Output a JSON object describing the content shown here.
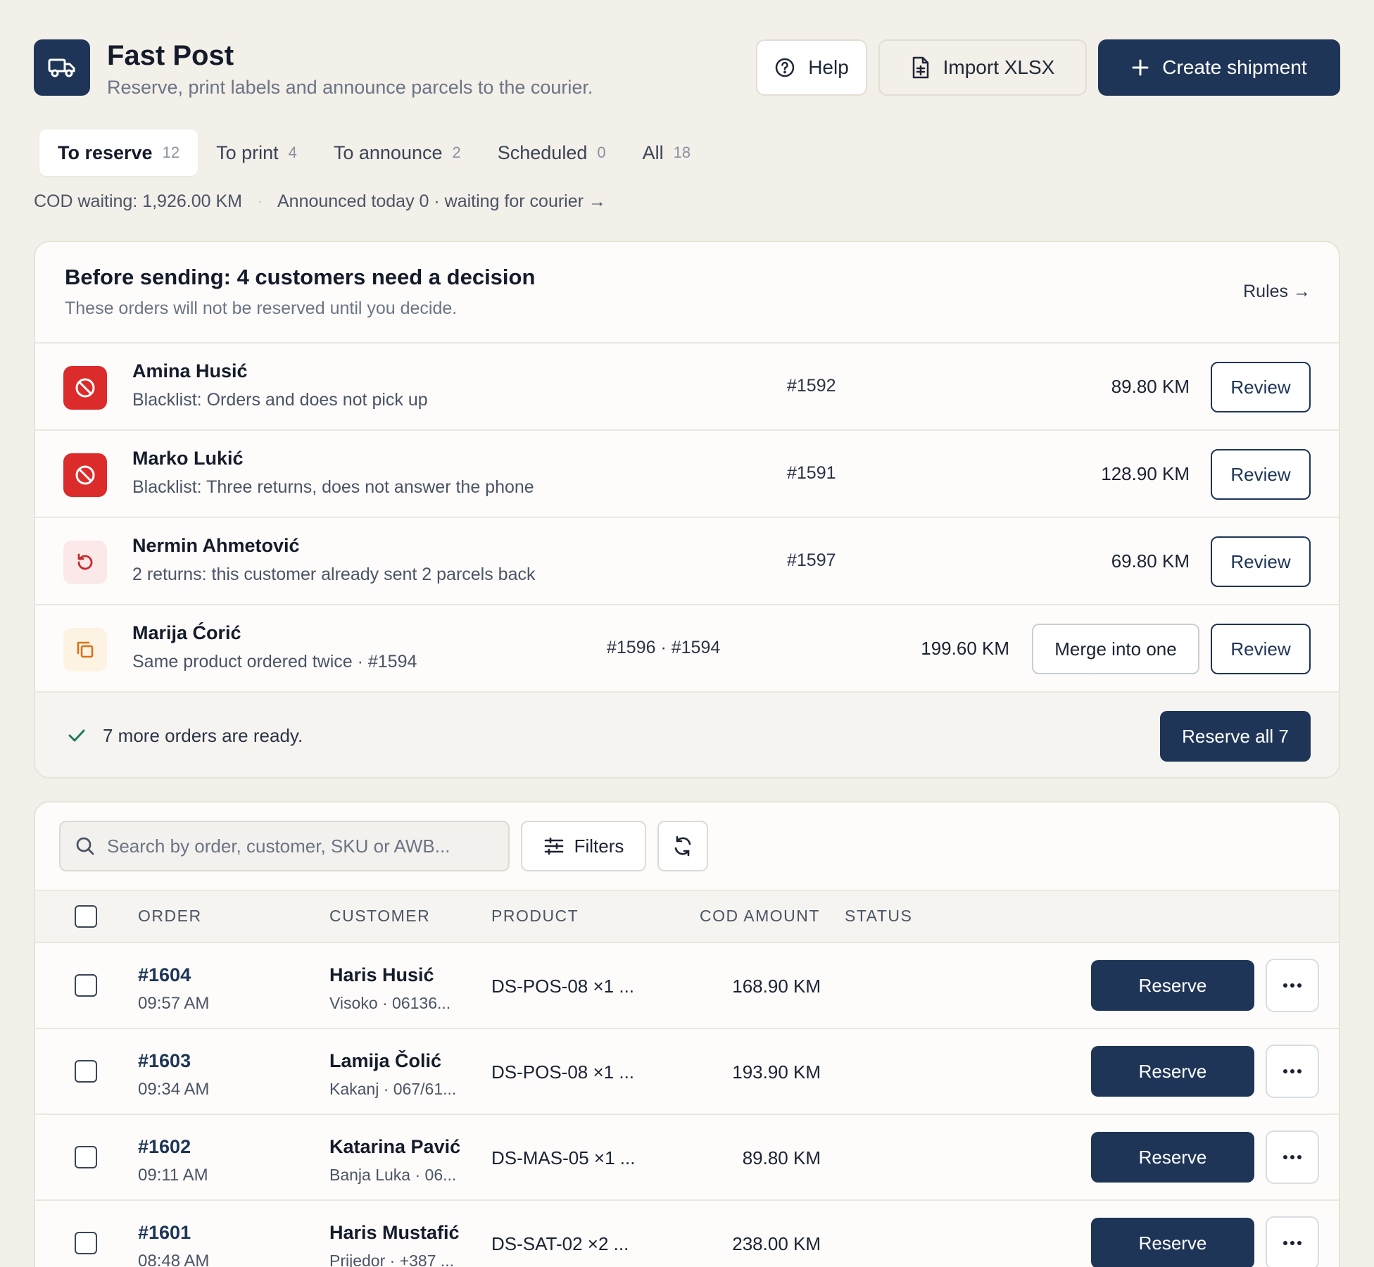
{
  "header": {
    "title": "Fast Post",
    "subtitle": "Reserve, print labels and announce parcels to the courier.",
    "help_label": "Help",
    "import_label": "Import XLSX",
    "create_label": "Create shipment",
    "logo_icon": "truck-icon"
  },
  "tabs": [
    {
      "label": "To reserve",
      "count": "12",
      "active": true
    },
    {
      "label": "To print",
      "count": "4"
    },
    {
      "label": "To announce",
      "count": "2"
    },
    {
      "label": "Scheduled",
      "count": "0"
    },
    {
      "label": "All",
      "count": "18"
    }
  ],
  "status_line": {
    "cod_waiting": "COD waiting: 1,926.00 KM",
    "announced": "Announced today 0 · waiting for courier →"
  },
  "decision": {
    "title": "Before sending: 4 customers need a decision",
    "subtitle": "These orders will not be reserved until you decide.",
    "rules_label": "Rules →",
    "review_label": "Review",
    "merge_label": "Merge into one",
    "rows": [
      {
        "name": "Amina Husić",
        "reason": "Blacklist: Orders and does not pick up",
        "order": "#1592",
        "amount": "89.80 KM",
        "icon": "blocked-icon"
      },
      {
        "name": "Marko Lukić",
        "reason": "Blacklist: Three returns, does not answer the phone",
        "order": "#1591",
        "amount": "128.90 KM",
        "icon": "blocked-icon"
      },
      {
        "name": "Nermin Ahmetović",
        "reason": "2 returns: this customer already sent 2 parcels back",
        "order": "#1597",
        "amount": "69.80 KM",
        "icon": "return-icon"
      },
      {
        "name": "Marija Ćorić",
        "reason": "Same product ordered twice · #1594",
        "order": "#1596 · #1594",
        "amount": "199.60 KM",
        "icon": "duplicate-icon"
      }
    ],
    "ready_text": "7 more orders are ready.",
    "reserve_all_label": "Reserve all 7"
  },
  "orders": {
    "search_placeholder": "Search by order, customer, SKU or AWB...",
    "filters_label": "Filters",
    "columns": [
      "ORDER",
      "CUSTOMER",
      "PRODUCT",
      "COD AMOUNT",
      "STATUS"
    ],
    "reserve_label": "Reserve",
    "rows": [
      {
        "order": "#1604",
        "time": "09:57 AM",
        "customer": "Haris Husić",
        "location": "Visoko · 06136...",
        "product": "DS-POS-08 ×1 ...",
        "amount": "168.90 KM"
      },
      {
        "order": "#1603",
        "time": "09:34 AM",
        "customer": "Lamija Čolić",
        "location": "Kakanj · 067/61...",
        "product": "DS-POS-08 ×1 ...",
        "amount": "193.90 KM"
      },
      {
        "order": "#1602",
        "time": "09:11 AM",
        "customer": "Katarina Pavić",
        "location": "Banja Luka · 06...",
        "product": "DS-MAS-05 ×1 ...",
        "amount": "89.80 KM"
      },
      {
        "order": "#1601",
        "time": "08:48 AM",
        "customer": "Haris Mustafić",
        "location": "Prijedor · +387 ...",
        "product": "DS-SAT-02 ×2 ...",
        "amount": "238.00 KM"
      }
    ]
  },
  "colors": {
    "primary": "#1e3557",
    "background": "#f3efe9",
    "danger": "#dc2b2b",
    "success": "#1f7a5a"
  }
}
